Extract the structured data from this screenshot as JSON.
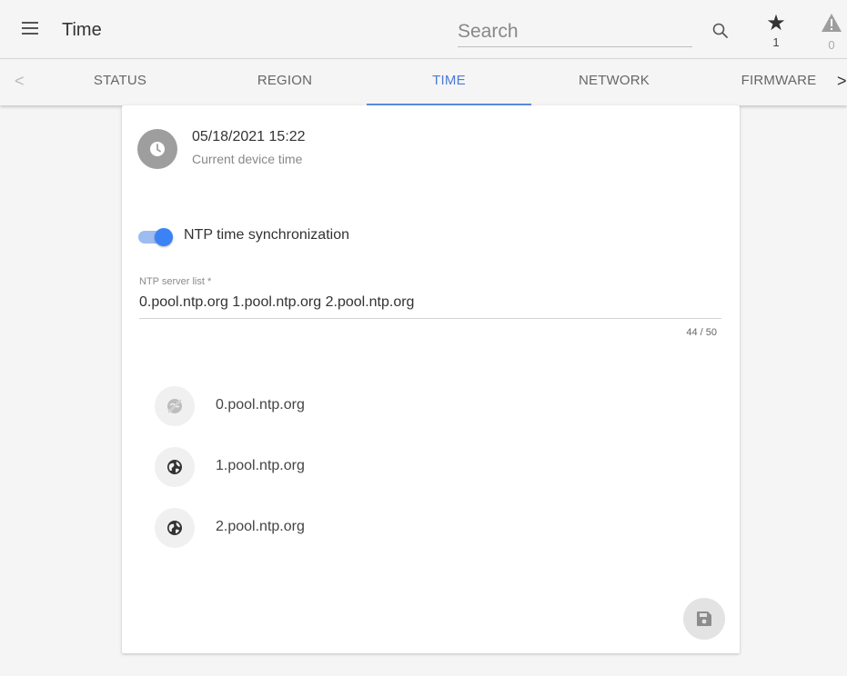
{
  "header": {
    "title": "Time",
    "search_placeholder": "Search",
    "favorites_count": "1",
    "alerts_count": "0",
    "icons": [
      "menu-icon",
      "search-icon",
      "star-icon",
      "warning-icon"
    ]
  },
  "tabs": {
    "items": [
      {
        "label": "STATUS"
      },
      {
        "label": "REGION"
      },
      {
        "label": "TIME"
      },
      {
        "label": "NETWORK"
      },
      {
        "label": "FIRMWARE"
      }
    ],
    "active": "TIME",
    "prev_glyph": "<",
    "next_glyph": ">"
  },
  "device_time": {
    "value": "05/18/2021 15:22",
    "label": "Current device time",
    "icon": "clock-icon"
  },
  "ntp": {
    "toggle_label": "NTP time synchronization",
    "enabled": true,
    "field_label": "NTP server list *",
    "field_value": "0.pool.ntp.org 1.pool.ntp.org 2.pool.ntp.org",
    "counter": "44 / 50"
  },
  "servers": [
    {
      "name": "0.pool.ntp.org",
      "status": "unreachable",
      "icon": "globe-off-icon"
    },
    {
      "name": "1.pool.ntp.org",
      "status": "reachable",
      "icon": "globe-icon"
    },
    {
      "name": "2.pool.ntp.org",
      "status": "reachable",
      "icon": "globe-icon"
    }
  ],
  "colors": {
    "accent": "#3b82f6",
    "active_tab": "#4a7bd6",
    "background": "#f5f5f5"
  }
}
